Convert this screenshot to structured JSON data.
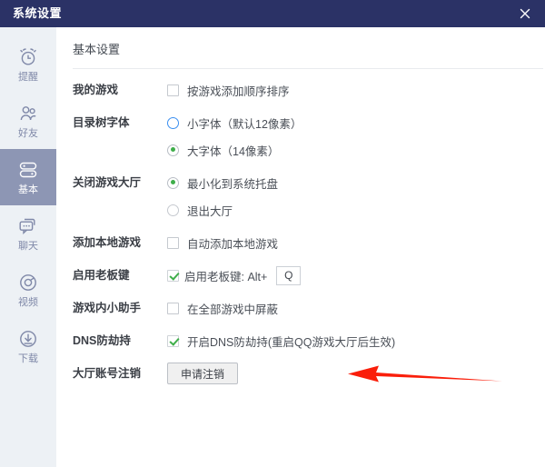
{
  "window": {
    "title": "系统设置",
    "close_icon": "close-icon",
    "titlebar_color": "#2b3266"
  },
  "sidebar": {
    "background": "#edf1f5",
    "active_background": "#8d96b4",
    "items": [
      {
        "label": "提醒",
        "icon": "alarm-clock-icon",
        "active": false
      },
      {
        "label": "好友",
        "icon": "friends-icon",
        "active": false
      },
      {
        "label": "基本",
        "icon": "basic-settings-icon",
        "active": true
      },
      {
        "label": "聊天",
        "icon": "chat-bubbles-icon",
        "active": false
      },
      {
        "label": "视频",
        "icon": "video-camera-icon",
        "active": false
      },
      {
        "label": "下载",
        "icon": "download-icon",
        "active": false
      }
    ]
  },
  "content": {
    "section_title": "基本设置",
    "rows": [
      {
        "label": "我的游戏",
        "options": [
          {
            "type": "checkbox",
            "text": "按游戏添加顺序排序",
            "checked": false
          }
        ]
      },
      {
        "label": "目录树字体",
        "options": [
          {
            "type": "radio",
            "text": "小字体（默认12像素）",
            "checked": false,
            "hover": true
          },
          {
            "type": "radio",
            "text": "大字体（14像素）",
            "checked": true,
            "hover": false
          }
        ]
      },
      {
        "label": "关闭游戏大厅",
        "options": [
          {
            "type": "radio",
            "text": "最小化到系统托盘",
            "checked": true,
            "hover": false
          },
          {
            "type": "radio",
            "text": "退出大厅",
            "checked": false,
            "hover": false
          }
        ]
      },
      {
        "label": "添加本地游戏",
        "options": [
          {
            "type": "checkbox",
            "text": "自动添加本地游戏",
            "checked": false
          }
        ]
      },
      {
        "label": "启用老板键",
        "options": [
          {
            "type": "checkbox-key",
            "text": "启用老板键: Alt+",
            "checked": true,
            "key_value": "Q"
          }
        ]
      },
      {
        "label": "游戏内小助手",
        "options": [
          {
            "type": "checkbox",
            "text": "在全部游戏中屏蔽",
            "checked": false
          }
        ]
      },
      {
        "label": "DNS防劫持",
        "options": [
          {
            "type": "checkbox",
            "text": "开启DNS防劫持(重启QQ游戏大厅后生效)",
            "checked": true
          }
        ]
      },
      {
        "label": "大厅账号注销",
        "options": [
          {
            "type": "button",
            "text": "申请注销"
          }
        ]
      }
    ]
  },
  "annotation": {
    "type": "arrow",
    "direction": "left",
    "color": "#fa1e0a",
    "points_to": "申请注销"
  },
  "colors": {
    "accent_green": "#3fae4a",
    "hover_blue": "#3b8ff0",
    "annotation_red": "#fa1e0a"
  }
}
